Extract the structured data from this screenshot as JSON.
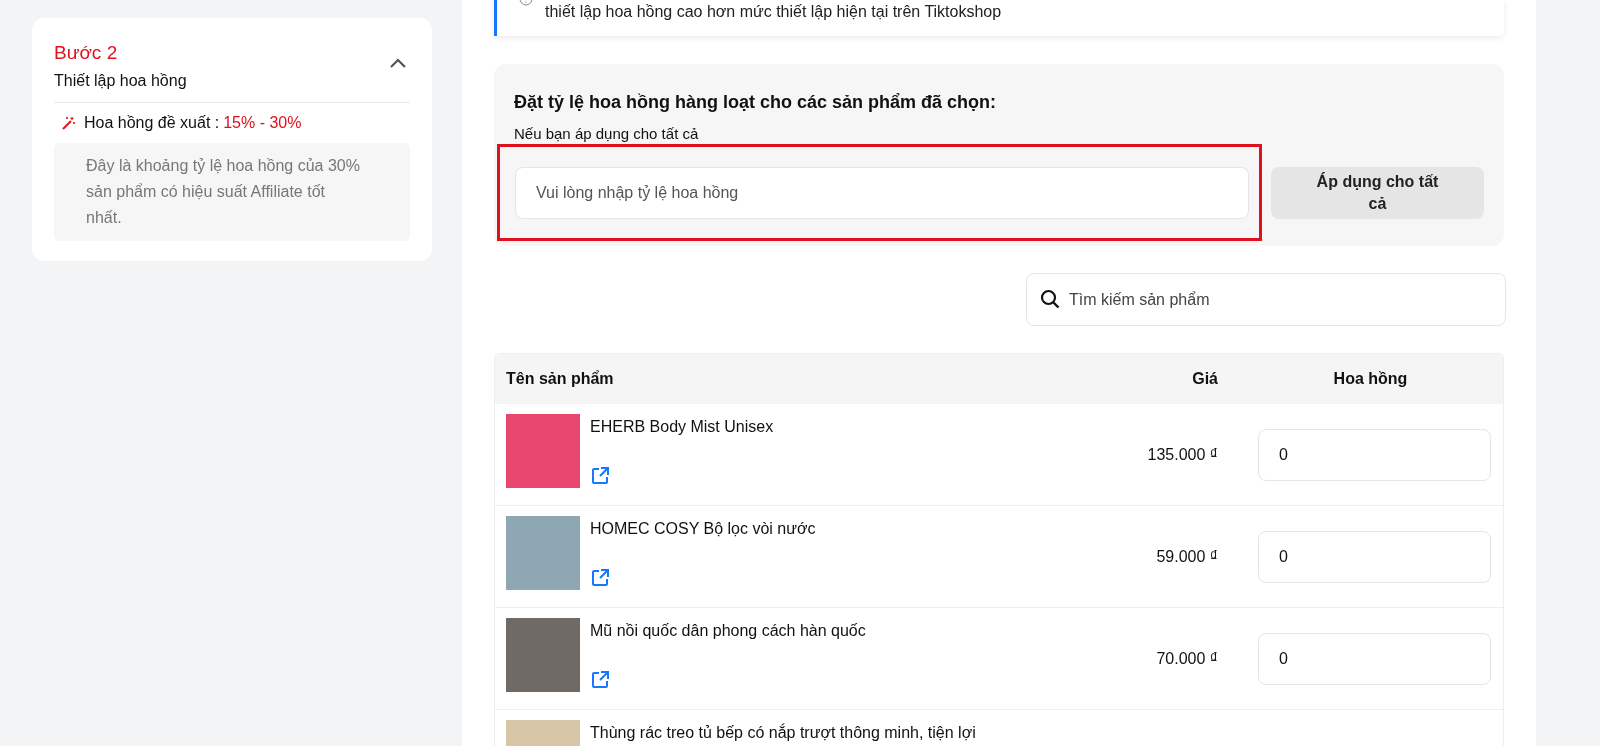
{
  "step_card": {
    "step": "Bước 2",
    "title": "Thiết lập hoa hồng",
    "expanded": true,
    "suggest_label": "Hoa hồng đề xuất :",
    "suggest_value": "15% - 30%",
    "note": "Đây là khoảng tỷ lệ hoa hồng của 30% sản phẩm có hiệu suất Affiliate tốt nhất."
  },
  "info": {
    "text": "thiết lập hoa hồng cao hơn mức thiết lập hiện tại trên Tiktokshop"
  },
  "bulk": {
    "title": "Đặt tỷ lệ hoa hồng hàng loạt cho các sản phẩm đã chọn:",
    "subtitle": "Nếu bạn áp dụng cho tất cả",
    "placeholder": "Vui lòng nhập tỷ lệ hoa hồng",
    "button": "Áp dụng cho tất cả"
  },
  "search": {
    "placeholder": "Tìm kiếm sản phẩm"
  },
  "table": {
    "columns": [
      "Tên sản phẩm",
      "Giá",
      "Hoa hồng"
    ],
    "rows": [
      {
        "name": "EHERB Body Mist Unisex",
        "price": "135.000 ₫",
        "commission": "0"
      },
      {
        "name": "HOMEC COSY Bộ lọc vòi nước",
        "price": "59.000 ₫",
        "commission": "0"
      },
      {
        "name": "Mũ nồi quốc dân phong cách hàn quốc",
        "price": "70.000 ₫",
        "commission": "0"
      },
      {
        "name": "Thùng rác treo tủ bếp có nắp trượt thông minh, tiện lợi"
      }
    ]
  }
}
